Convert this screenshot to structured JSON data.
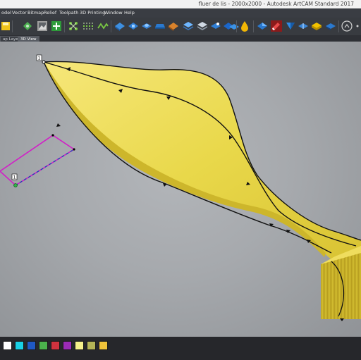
{
  "window": {
    "title": "fluer de lis - 2000x2000 - Autodesk ArtCAM Standard 2017"
  },
  "menu": {
    "items": [
      "odel",
      "Vector",
      "Bitmap",
      "Relief",
      "Toolpath",
      "3D Printing",
      "Window",
      "Help"
    ]
  },
  "tabs": [
    {
      "label": "ap Layer",
      "active": false
    },
    {
      "label": "3D View",
      "active": true
    }
  ],
  "viewport": {
    "markers": {
      "vector_start": "1",
      "rect_start": "1"
    },
    "colors": {
      "background": "#a9acb0",
      "relief": "#e3d240",
      "vector": "#111111",
      "rect_outline": "#d21ec8",
      "rect_dashed": "#1f3fb8"
    }
  },
  "toolbar": {
    "icons": [
      "save-icon",
      "bitmap-to-vector-icon",
      "image-icon",
      "add-icon",
      "node-edit-icon",
      "vector-chain-icon",
      "wave-icon",
      "relief-shape-icon",
      "relief-add-icon",
      "relief-dome-icon",
      "relief-extrude-icon",
      "relief-bevel-icon",
      "relief-layer-icon",
      "relief-stack-icon",
      "relief-sculpt-icon",
      "relief-blue-icon",
      "relief-smooth-icon",
      "drop-icon",
      "relief-merge-icon",
      "eraser-icon",
      "relief-cut-icon",
      "relief-slice-icon",
      "relief-gold-icon",
      "relief-flat-icon",
      "measure-icon",
      "more-icon"
    ]
  },
  "swatches": [
    "#ffffff",
    "#19d1e6",
    "#1f59c4",
    "#4bb44c",
    "#d0323e",
    "#9b2bb8",
    "#f5f08a",
    "#b4b456",
    "#f0c33a"
  ]
}
